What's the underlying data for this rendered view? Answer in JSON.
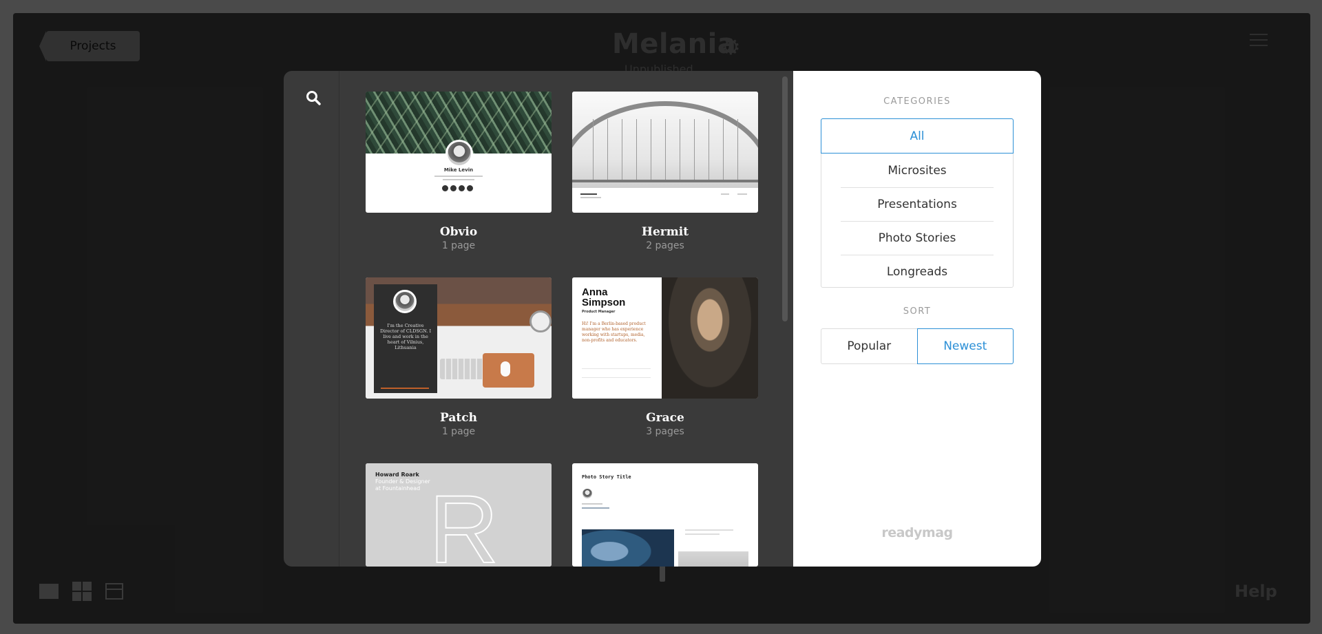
{
  "background_app": {
    "projects_button": "Projects",
    "project_title": "Melania",
    "project_subtitle": "Unpublished",
    "help_label": "Help"
  },
  "search": {
    "icon": "search-icon"
  },
  "templates": [
    {
      "title": "Obvio",
      "pages": "1 page",
      "thumb_text": {
        "name": "Mike Levin"
      }
    },
    {
      "title": "Hermit",
      "pages": "2 pages"
    },
    {
      "title": "Patch",
      "pages": "1 page",
      "thumb_text": {
        "bio": "I'm the Creative Director of CLDSGN. I live and work in the heart of Vilnius, Lithuania"
      }
    },
    {
      "title": "Grace",
      "pages": "3 pages",
      "thumb_text": {
        "name": "Anna Simpson",
        "role": "Product Manager",
        "bio": "Hi! I'm a Berlin-based product manager who has experience working with startups, media, non-profits and educators."
      }
    },
    {
      "title": "",
      "pages": "",
      "thumb_text": {
        "name": "Howard Roark",
        "sub": "Founder & Designer at Fountainhead",
        "letter": "R"
      }
    },
    {
      "title": "",
      "pages": "",
      "thumb_text": {
        "heading": "Photo Story Title"
      }
    }
  ],
  "categories": {
    "label": "CATEGORIES",
    "items": [
      "All",
      "Microsites",
      "Presentations",
      "Photo Stories",
      "Longreads"
    ],
    "selected": "All"
  },
  "sort": {
    "label": "SORT",
    "options": [
      "Popular",
      "Newest"
    ],
    "selected": "Newest"
  },
  "logo": "readymag",
  "colors": {
    "accent": "#2b8fd6",
    "modal_dark": "#3a3a3a"
  }
}
